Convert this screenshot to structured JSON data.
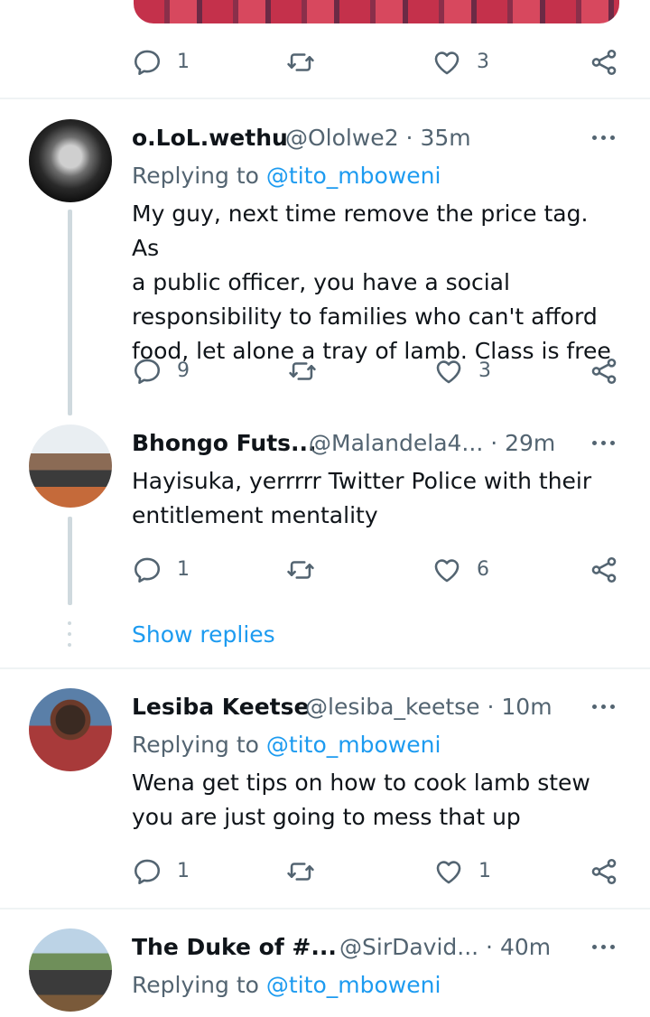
{
  "top_tweet": {
    "actions": {
      "replies": "1",
      "likes": "3"
    }
  },
  "tweets": [
    {
      "display_name": "o.LoL.wethu",
      "meta": "@Ololwe2 · 35m",
      "replying_prefix": "Replying to",
      "replying_handle": "@tito_mboweni",
      "text_lines": [
        "My guy, next time remove the price tag. As",
        "a public officer, you have a social",
        "responsibility to families who can't afford",
        "food, let alone a tray of lamb. Class is free"
      ],
      "actions": {
        "replies": "9",
        "likes": "3"
      }
    },
    {
      "display_name": "Bhongo Futs...",
      "meta": "@Malandela4... · 29m",
      "text_lines": [
        "Hayisuka, yerrrrr Twitter Police with their",
        "entitlement mentality"
      ],
      "actions": {
        "replies": "1",
        "likes": "6"
      }
    },
    {
      "display_name": "Lesiba Keetse",
      "meta": "@lesiba_keetse · 10m",
      "replying_prefix": "Replying to",
      "replying_handle": "@tito_mboweni",
      "text_lines": [
        "Wena get tips on how to cook lamb stew",
        "you are just going to mess that up"
      ],
      "actions": {
        "replies": "1",
        "likes": "1"
      }
    },
    {
      "display_name": "The Duke of #...",
      "meta": "@SirDavid... · 40m",
      "replying_prefix": "Replying to",
      "replying_handle": "@tito_mboweni"
    }
  ],
  "show_replies": "Show replies",
  "icons": {
    "reply": "reply-icon",
    "retweet": "retweet-icon",
    "like": "heart-icon",
    "share": "share-icon",
    "more": "more-icon"
  },
  "colors": {
    "accent": "#1d9bf0",
    "secondary_text": "#536471",
    "divider": "#eff3f4"
  }
}
